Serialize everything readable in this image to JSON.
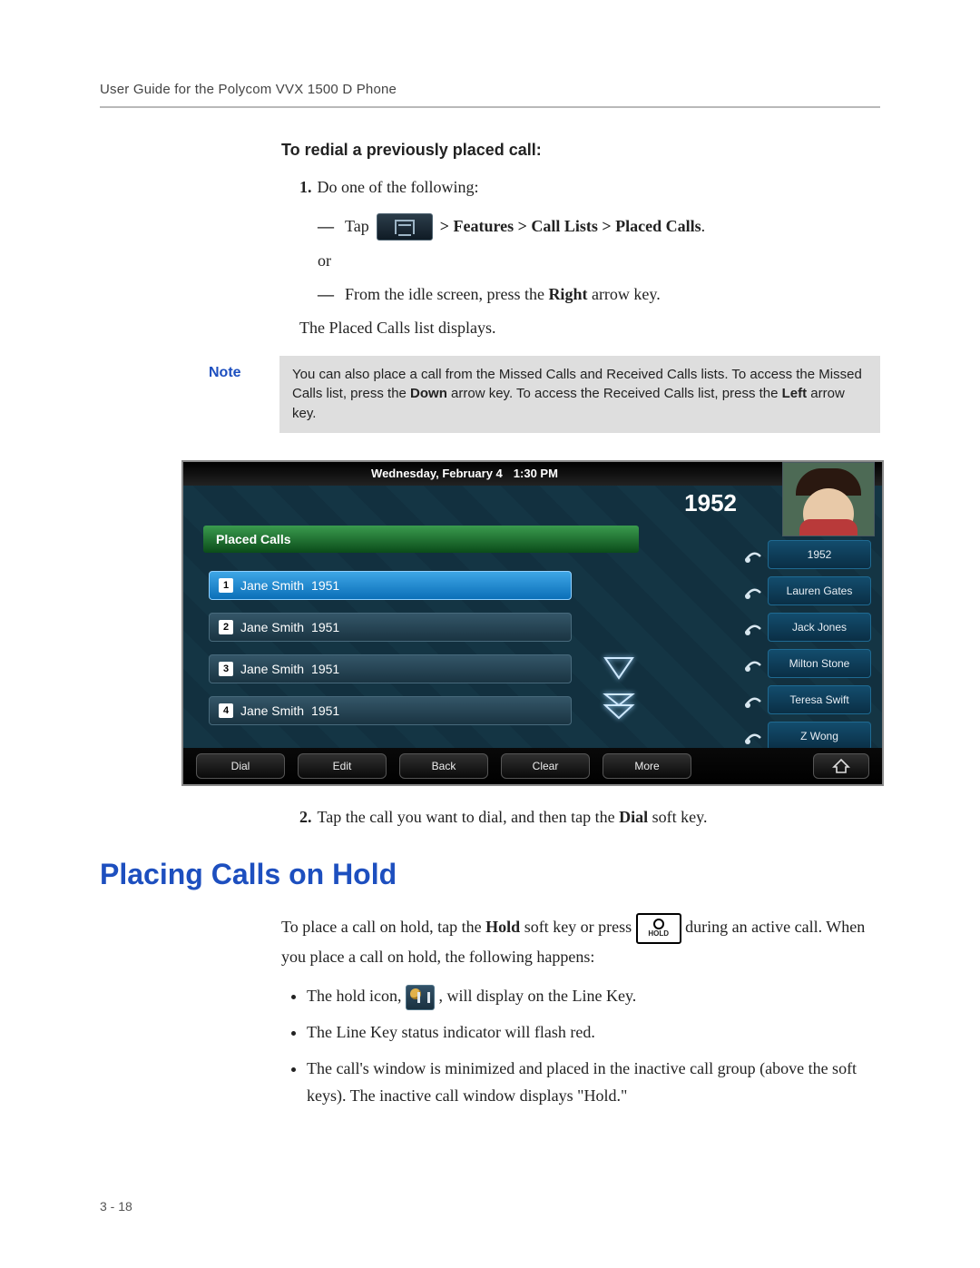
{
  "header": {
    "running": "User Guide for the Polycom VVX 1500 D Phone"
  },
  "section1": {
    "title": "To redial a previously placed call:",
    "step1_lead": "Do one of the following:",
    "opt_tap": "Tap",
    "opt_path": " > Features > Call Lists > Placed Calls",
    "opt_path_dot": ".",
    "or": "or",
    "opt_right_a": "From the idle screen, press the ",
    "opt_right_b": "Right",
    "opt_right_c": " arrow key.",
    "result": "The Placed Calls list displays."
  },
  "note": {
    "label": "Note",
    "t1": "You can also place a call from the Missed Calls and Received Calls lists. To access the Missed Calls list, press the ",
    "down": "Down",
    "t2": " arrow key. To access the Received Calls list, press the ",
    "left": "Left",
    "t3": " arrow key."
  },
  "phone": {
    "date": "Wednesday, February 4",
    "time": "1:30 PM",
    "ext": "1952",
    "list_title": "Placed Calls",
    "calls": [
      {
        "idx": "1",
        "name": "Jane Smith",
        "num": "1951"
      },
      {
        "idx": "2",
        "name": "Jane Smith",
        "num": "1951"
      },
      {
        "idx": "3",
        "name": "Jane Smith",
        "num": "1951"
      },
      {
        "idx": "4",
        "name": "Jane Smith",
        "num": "1951"
      }
    ],
    "linekeys": [
      "1952",
      "Lauren Gates",
      "Jack Jones",
      "Milton Stone",
      "Teresa Swift",
      "Z Wong"
    ],
    "softkeys": [
      "Dial",
      "Edit",
      "Back",
      "Clear",
      "More"
    ]
  },
  "step2": {
    "a": "Tap the call you want to dial, and then tap the ",
    "b": "Dial",
    "c": " soft key."
  },
  "h2": "Placing Calls on Hold",
  "hold": {
    "p1a": "To place a call on hold, tap the ",
    "p1b": "Hold",
    "p1c": " soft key or press ",
    "p1d": " during an active call. When you place a call on hold, the following happens:",
    "key_label": "HOLD",
    "b1a": "The hold icon, ",
    "b1b": " , will display on the Line Key.",
    "b2": "The Line Key status indicator will flash red.",
    "b3": "The call's window is minimized and placed in the inactive call group (above the soft keys). The inactive call window displays \"Hold.\""
  },
  "page_num": "3 - 18"
}
